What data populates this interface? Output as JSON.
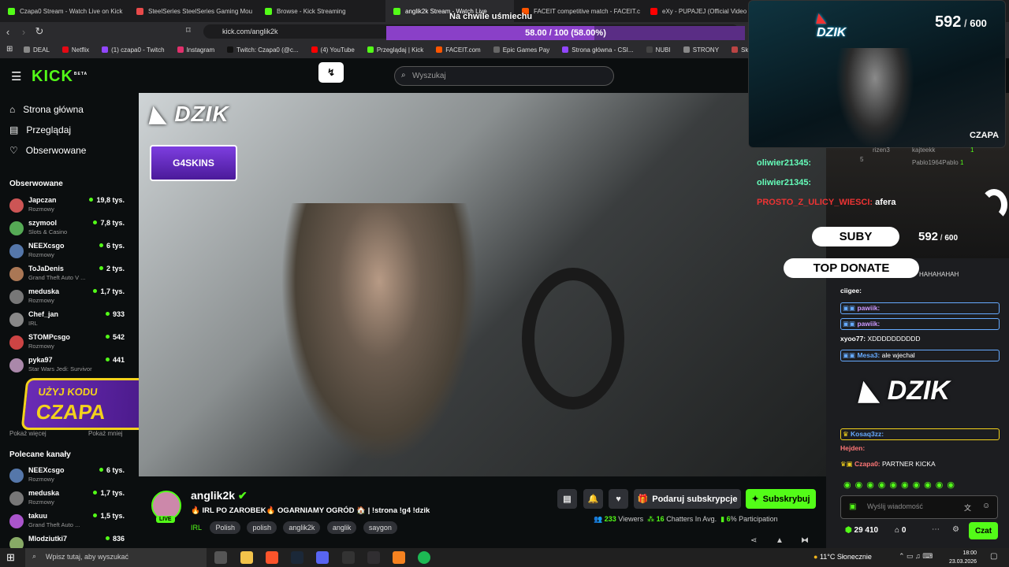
{
  "browser": {
    "tabs": [
      {
        "title": "Czapa0 Stream - Watch Live on Kick",
        "color": "#53fc18",
        "active": false
      },
      {
        "title": "SteelSeries SteelSeries Gaming Mou",
        "color": "#e84a4a",
        "active": false
      },
      {
        "title": "Browse - Kick Streaming",
        "color": "#53fc18",
        "active": false
      },
      {
        "title": "anglik2k Stream - Watch Live",
        "color": "#53fc18",
        "active": true
      },
      {
        "title": "FACEIT competitive match - FACEIT.c",
        "color": "#ff5500",
        "active": false
      },
      {
        "title": "eXy - PUPAJEJ (Official Video 20",
        "color": "#ff0000",
        "active": false
      }
    ],
    "url": "kick.com/anglik2k",
    "bookmarks": [
      {
        "label": "DEAL",
        "color": "#888"
      },
      {
        "label": "Netflix",
        "color": "#e50914"
      },
      {
        "label": "(1) czapa0 - Twitch",
        "color": "#9146ff"
      },
      {
        "label": "Instagram",
        "color": "#e1306c"
      },
      {
        "label": "Twitch: Czapa0 (@c...",
        "color": "#111"
      },
      {
        "label": "(4) YouTube",
        "color": "#ff0000"
      },
      {
        "label": "Przeglądaj | Kick",
        "color": "#53fc18"
      },
      {
        "label": "FACEIT.com",
        "color": "#ff5500"
      },
      {
        "label": "Epic Games Pay",
        "color": "#666"
      },
      {
        "label": "Strona główna - CSI...",
        "color": "#9146ff"
      },
      {
        "label": "NUBI",
        "color": "#444"
      },
      {
        "label": "STRONY",
        "color": "#888"
      },
      {
        "label": "Skrzynki CS...",
        "color": "#b44"
      }
    ]
  },
  "overlay": {
    "poll_title": "Na chwile uśmiechu",
    "poll_value": "58.00 / 100 (58.00%)",
    "poll_progress": 0.58,
    "sub_count": "592",
    "sub_goal": "600",
    "dzik_label": "DZIK",
    "cam_name": "CZAPA",
    "suby_label": "SUBY",
    "top_donate_label": "TOP DONATE",
    "g4skins_label": "G4SKINS",
    "promo_line1": "UŻYJ KODU",
    "promo_line2": "CZAPA",
    "dzik_chat_logo": "DZIK"
  },
  "kick": {
    "logo": "KICK",
    "beta": "BETA",
    "search_placeholder": "Wyszukaj",
    "nav": [
      {
        "label": "Strona główna",
        "icon": "home-icon"
      },
      {
        "label": "Przeglądaj",
        "icon": "browse-icon"
      },
      {
        "label": "Obserwowane",
        "icon": "heart-icon"
      }
    ],
    "followed_header": "Obserwowane",
    "followed": [
      {
        "name": "Japczan",
        "category": "Rozmowy",
        "viewers": "19,8 tys.",
        "color": "#c55"
      },
      {
        "name": "szymool",
        "category": "Slots & Casino",
        "viewers": "7,8 tys.",
        "color": "#5a5"
      },
      {
        "name": "NEEXcsgo",
        "category": "Rozmowy",
        "viewers": "6 tys.",
        "color": "#57a"
      },
      {
        "name": "ToJaDenis",
        "category": "Grand Theft Auto V ...",
        "viewers": "2 tys.",
        "color": "#a75"
      },
      {
        "name": "meduska",
        "category": "Rozmowy",
        "viewers": "1,7 tys.",
        "color": "#777"
      },
      {
        "name": "Chef_jan",
        "category": "IRL",
        "viewers": "933",
        "color": "#888"
      },
      {
        "name": "STOMPcsgo",
        "category": "Rozmowy",
        "viewers": "542",
        "color": "#c44"
      },
      {
        "name": "pyka97",
        "category": "Star Wars Jedi: Survivor",
        "viewers": "441",
        "color": "#a8a"
      }
    ],
    "show_more": "Pokaż więcej",
    "show_less": "Pokaż mniej",
    "recommended_header": "Polecane kanały",
    "recommended": [
      {
        "name": "NEEXcsgo",
        "category": "Rozmowy",
        "viewers": "6 tys.",
        "color": "#57a"
      },
      {
        "name": "meduska",
        "category": "Rozmowy",
        "viewers": "1,7 tys.",
        "color": "#777"
      },
      {
        "name": "takuu",
        "category": "Grand Theft Auto ...",
        "viewers": "1,5 tys.",
        "color": "#a5c"
      },
      {
        "name": "Mlodziutki7",
        "category": "",
        "viewers": "836",
        "color": "#8a6"
      }
    ]
  },
  "stream": {
    "streamer": "anglik2k",
    "live_badge": "LIVE",
    "title": "🔥 IRL PO ZAROBEK🔥 OGARNIAMY OGRÓD 🏠 | !strona !g4 !dzik",
    "category": "IRL",
    "tags": [
      "Polish",
      "polish",
      "anglik2k",
      "anglik",
      "saygon"
    ],
    "gift_label": "Podaruj subskrypcje",
    "subscribe_label": "Subskrybuj",
    "viewers": "233",
    "viewers_label": "Viewers",
    "chatters": "16",
    "chatters_label": "Chatters In Avg.",
    "participation": "6",
    "participation_label": "% Participation"
  },
  "chat": {
    "messages": [
      {
        "user": "oliwier21345:",
        "text": "",
        "color": "#6fb"
      },
      {
        "user": "oliwier21345:",
        "text": "",
        "color": "#6fb"
      },
      {
        "user": "PROSTO_Z_ULICY_WIESCI:",
        "text": "afera",
        "color": "#e33"
      },
      {
        "user": "ciigee:",
        "text": "",
        "color": "#fff"
      },
      {
        "user": "pawiik:",
        "text": "",
        "color": "#c9f"
      },
      {
        "user": "pawiik:",
        "text": "",
        "color": "#c9f"
      },
      {
        "user": "xyoo77:",
        "text": "XDDDDDDDDDD",
        "color": "#fff"
      },
      {
        "user": "Mesa3:",
        "text": "ale wjechal",
        "color": "#6af"
      },
      {
        "user": "Kosaq3zz:",
        "text": "",
        "color": "#6af"
      },
      {
        "user": "Hejden:",
        "text": "",
        "color": "#f77"
      },
      {
        "user": "Czapa0:",
        "text": "PARTNER KICKA",
        "color": "#f77"
      }
    ],
    "top_donors": [
      {
        "name": "rizen3",
        "amount": "5"
      },
      {
        "name": "kajteekk",
        "amount": "1"
      },
      {
        "name": "Pablo1964Pablo",
        "amount": "1"
      }
    ],
    "laugh_text": "HAHAHAHAH",
    "input_placeholder": "Wyślij wiadomość",
    "points": "29 410",
    "zero": "0",
    "chat_button": "Czat"
  },
  "taskbar": {
    "search_placeholder": "Wpisz tutaj, aby wyszukać",
    "weather": "11°C  Słonecznie",
    "time": "18:00",
    "date": "23.03.2026"
  },
  "colors": {
    "kick_green": "#53fc18",
    "poll_purple": "#8a40c8",
    "background": "#0b0e0f"
  }
}
